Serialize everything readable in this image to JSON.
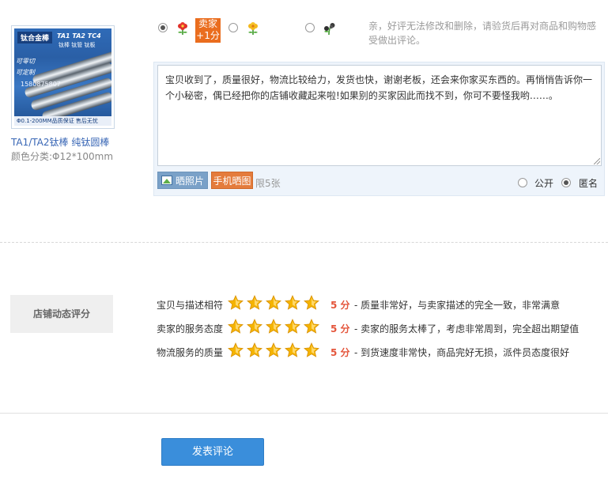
{
  "product": {
    "image": {
      "brand": "钛合金棒",
      "grades": "TA1 TA2 TC4",
      "subtitle": "钛棒 钛管 钛板",
      "tag1": "可零切",
      "tag2": "可定制",
      "phone": "1580875807",
      "footer": "Φ0.1-200MM品质保证 售后无忧"
    },
    "name": "TA1/TA2钛棒 纯钛圆棒",
    "spec": "颜色分类:Φ12*100mm"
  },
  "rating": {
    "selected": "good",
    "bonus_text": "卖家\n+1分",
    "hint": "亲，好评无法修改和删除，请验货后再对商品和购物感受做出评论。"
  },
  "comment": {
    "text": "宝贝收到了，质量很好，物流比较给力，发货也快，谢谢老板，还会来你家买东西的。再悄悄告诉你一个小秘密，偶已经把你的店铺收藏起来啦!如果别的买家因此而找不到，你可不要怪我哟……。",
    "photo_button": "晒照片",
    "mobile_button": "手机晒图",
    "limit": "限5张",
    "public_label": "公开",
    "anonymous_label": "匿名",
    "visibility": "anonymous"
  },
  "shop_rating": {
    "label": "店铺动态评分",
    "rows": [
      {
        "label": "宝贝与描述相符",
        "stars": 5,
        "score": "5 分",
        "desc": "- 质量非常好，与卖家描述的完全一致，非常满意"
      },
      {
        "label": "卖家的服务态度",
        "stars": 5,
        "score": "5 分",
        "desc": "- 卖家的服务太棒了，考虑非常周到，完全超出期望值"
      },
      {
        "label": "物流服务的质量",
        "stars": 5,
        "score": "5 分",
        "desc": "- 到货速度非常快，商品完好无损，派件员态度很好"
      }
    ]
  },
  "submit_button": "发表评论",
  "colors": {
    "accent_blue": "#3a8edb",
    "link_blue": "#3866b5",
    "orange": "#ea6d1e",
    "score_red": "#e4553b",
    "star_gold": "#f5b400"
  }
}
